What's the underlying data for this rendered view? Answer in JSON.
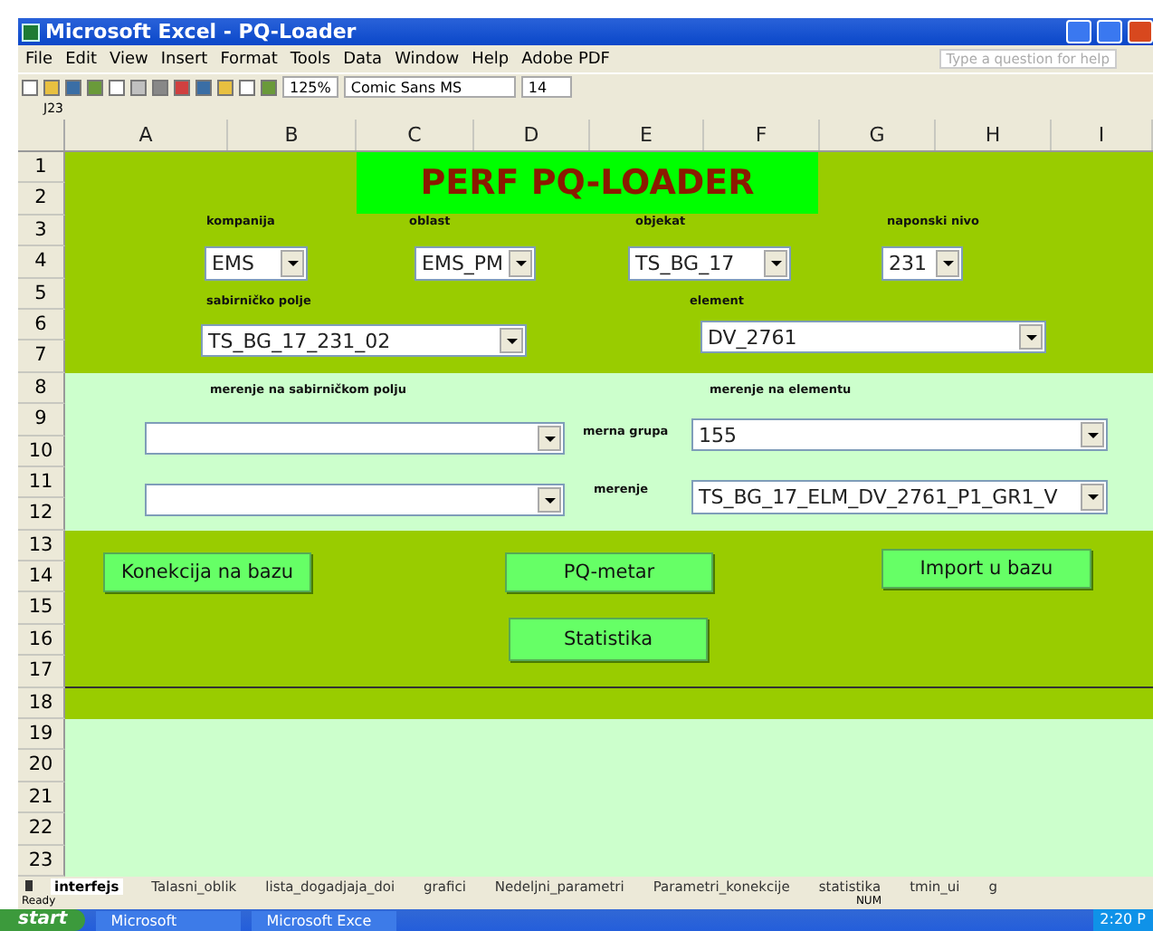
{
  "window": {
    "title": "Microsoft Excel - PQ-Loader"
  },
  "menu": [
    "File",
    "Edit",
    "View",
    "Insert",
    "Format",
    "Tools",
    "Data",
    "Window",
    "Help",
    "Adobe PDF"
  ],
  "help_box": {
    "placeholder": "Type a question for help"
  },
  "toolbar": {
    "zoom": "125%",
    "font": "Comic Sans MS",
    "font_size": "14"
  },
  "name_box": "J23",
  "columns": [
    "A",
    "B",
    "C",
    "D",
    "E",
    "F",
    "G",
    "H",
    "I"
  ],
  "rows": [
    "1",
    "2",
    "3",
    "4",
    "5",
    "6",
    "7",
    "8",
    "9",
    "10",
    "11",
    "12",
    "13",
    "14",
    "15",
    "16",
    "17",
    "18",
    "19",
    "20",
    "21",
    "22",
    "23"
  ],
  "sheet": {
    "title": "PERF PQ-LOADER",
    "labels": [
      "kompanija",
      "oblast",
      "objekat",
      "naponski nivo",
      "sabirničko polje",
      "element",
      "merenje na sabirničkom polju",
      "merenje na elementu",
      "merna grupa",
      "merenje"
    ],
    "combos": [
      {
        "kind": "filled",
        "value": "EMS"
      },
      {
        "kind": "filled",
        "value": "EMS_PM"
      },
      {
        "kind": "filled",
        "value": "TS_BG_17"
      },
      {
        "kind": "filled",
        "value": "231"
      },
      {
        "kind": "filled",
        "value": "TS_BG_17_231_02"
      },
      {
        "kind": "filled",
        "value": "DV_2761"
      },
      {
        "kind": "blank"
      },
      {
        "kind": "filled",
        "value": "155"
      },
      {
        "kind": "blank"
      },
      {
        "kind": "filled",
        "value": "TS_BG_17_ELM_DV_2761_P1_GR1_V"
      }
    ],
    "buttons": [
      "Konekcija na bazu",
      "PQ-metar",
      "Import u bazu",
      "Statistika"
    ]
  },
  "sheet_tabs": [
    {
      "label": "interfejs",
      "selected": true
    },
    {
      "label": "Talasni_oblik",
      "selected": false
    },
    {
      "label": "lista_dogadjaja_doi",
      "selected": false
    },
    {
      "label": "grafici",
      "selected": false
    },
    {
      "label": "Nedeljni_parametri",
      "selected": false
    },
    {
      "label": "Parametri_konekcije",
      "selected": false
    },
    {
      "label": "statistika",
      "selected": false
    },
    {
      "label": "tmin_ui",
      "selected": false
    },
    {
      "label": "g",
      "selected": false
    }
  ],
  "status_bar": {
    "left": "Ready",
    "right": "NUM"
  },
  "taskbar": {
    "start": "start",
    "items": [
      "Microsoft",
      "Microsoft Exce"
    ],
    "clock": "2:20 P"
  }
}
